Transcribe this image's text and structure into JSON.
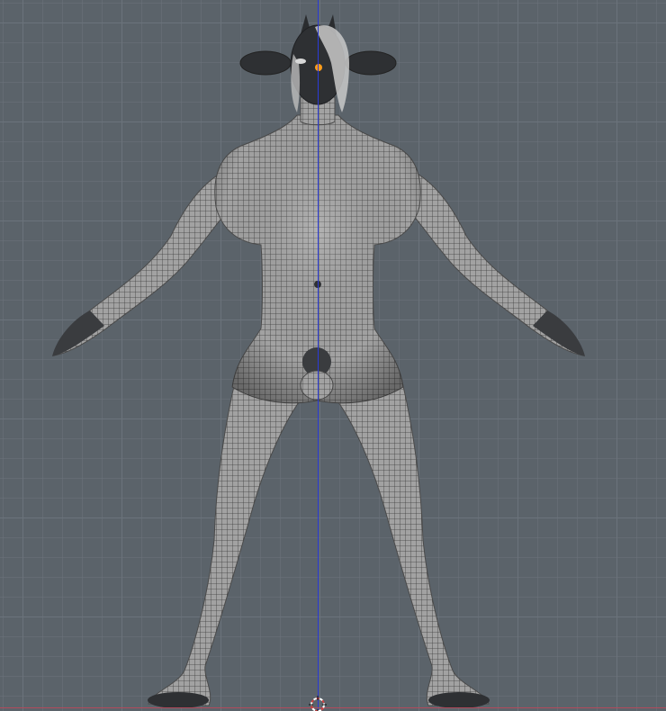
{
  "viewport": {
    "view": "front-orthographic",
    "background": "#5b636a",
    "grid_major": "#6b737b",
    "grid_minor": "#666e76"
  },
  "axes": {
    "z_axis_color": "#2b3bd8",
    "x_axis_color": "#b34a5c"
  },
  "model": {
    "object": "humanoid-mesh",
    "pose": "A-pose",
    "display": "wireframe-on-shaded",
    "mesh_color": "#9a9a9a",
    "wire_color": "#3a3a3a",
    "head_color": "#2e3033",
    "origin_dot_color": "#ff9d1a"
  },
  "cursor": {
    "icon": "3d-cursor-icon"
  }
}
